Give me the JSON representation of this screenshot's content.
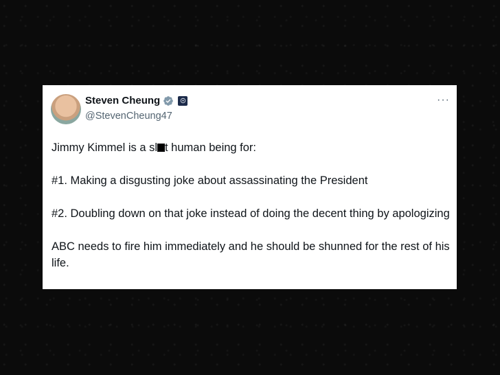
{
  "tweet": {
    "author_name": "Steven Cheung",
    "author_handle": "@StevenCheung47",
    "more_label": "···",
    "line1_prefix": "Jimmy Kimmel is a sl",
    "line1_suffix": "t human being for:",
    "point1": "#1. Making a disgusting joke about assassinating the President",
    "point2": "#2. Doubling down on that joke instead of doing the decent thing by apologizing",
    "closing": "ABC needs to fire him immediately and he should be shunned for the rest of his life."
  },
  "icons": {
    "verified": "verified-badge-icon",
    "affiliate": "affiliation-badge-icon",
    "more": "more-options-icon"
  },
  "colors": {
    "verified": "#829aab",
    "text": "#0f1419",
    "secondary": "#536471",
    "affiliate_badge": "#1c2b4a"
  }
}
